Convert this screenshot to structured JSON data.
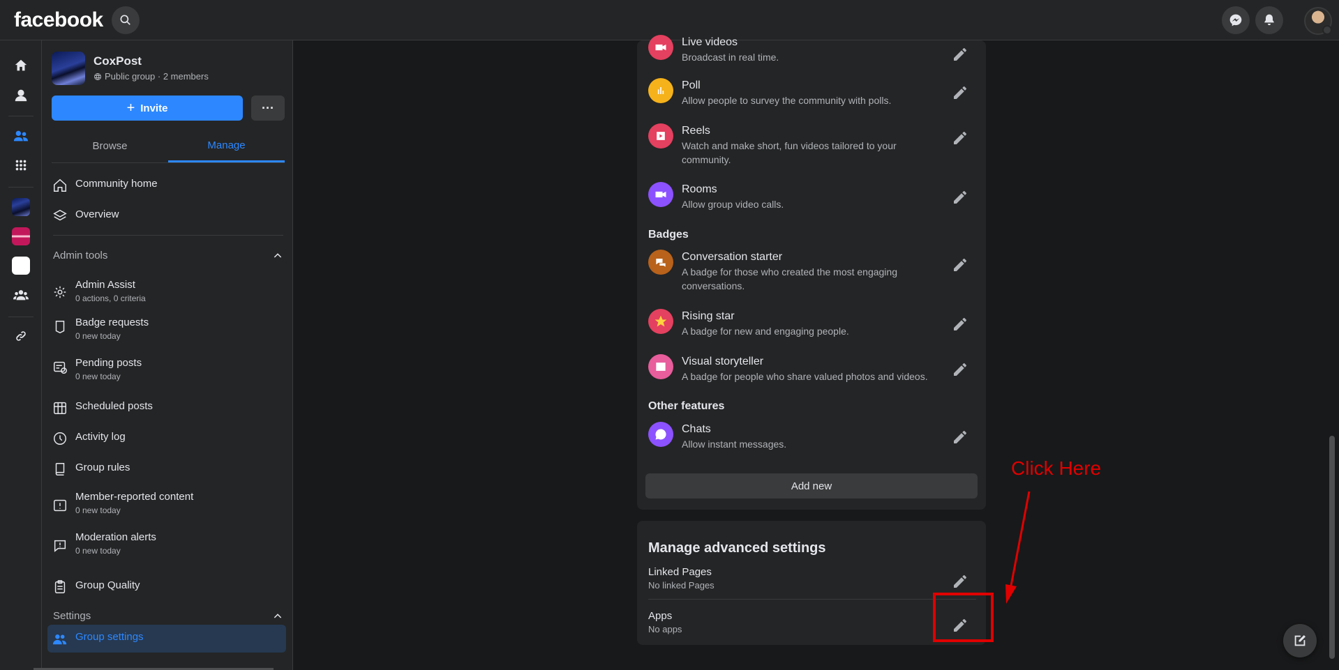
{
  "topbar": {
    "logo": "facebook"
  },
  "group": {
    "name": "CoxPost",
    "meta": "Public group · 2 members"
  },
  "actions": {
    "invite_label": "Invite",
    "more_label": "···"
  },
  "tabs": [
    {
      "label": "Browse"
    },
    {
      "label": "Manage"
    }
  ],
  "nav_top": [
    {
      "label": "Community home"
    },
    {
      "label": "Overview"
    }
  ],
  "admin_tools": {
    "title": "Admin tools",
    "items": [
      {
        "label": "Admin Assist",
        "sub": "0 actions, 0 criteria"
      },
      {
        "label": "Badge requests",
        "sub": "0 new today"
      },
      {
        "label": "Pending posts",
        "sub": "0 new today"
      },
      {
        "label": "Scheduled posts",
        "sub": ""
      },
      {
        "label": "Activity log",
        "sub": ""
      },
      {
        "label": "Group rules",
        "sub": ""
      },
      {
        "label": "Member-reported content",
        "sub": "0 new today"
      },
      {
        "label": "Moderation alerts",
        "sub": "0 new today"
      },
      {
        "label": "Group Quality",
        "sub": ""
      }
    ]
  },
  "settings": {
    "title": "Settings",
    "active_item": "Group settings"
  },
  "features": [
    {
      "title": "Live videos",
      "desc": "Broadcast in real time.",
      "color": "#e4405f"
    },
    {
      "title": "Poll",
      "desc": "Allow people to survey the community with polls.",
      "color": "#f5b21b"
    },
    {
      "title": "Reels",
      "desc": "Watch and make short, fun videos tailored to your community.",
      "color": "#e4405f"
    },
    {
      "title": "Rooms",
      "desc": "Allow group video calls.",
      "color": "#8c52ff"
    }
  ],
  "badges": {
    "title": "Badges",
    "items": [
      {
        "title": "Conversation starter",
        "desc": "A badge for those who created the most engaging conversations.",
        "color": "#b8621b"
      },
      {
        "title": "Rising star",
        "desc": "A badge for new and engaging people.",
        "color": "#e4405f"
      },
      {
        "title": "Visual storyteller",
        "desc": "A badge for people who share valued photos and videos.",
        "color": "#e85d9c"
      }
    ]
  },
  "other_features": {
    "title": "Other features",
    "items": [
      {
        "title": "Chats",
        "desc": "Allow instant messages.",
        "color": "#8c52ff"
      }
    ]
  },
  "add_new_label": "Add new",
  "advanced": {
    "title": "Manage advanced settings",
    "rows": [
      {
        "title": "Linked Pages",
        "sub": "No linked Pages"
      },
      {
        "title": "Apps",
        "sub": "No apps"
      }
    ]
  },
  "annotation": {
    "text": "Click Here",
    "color": "#e00000"
  }
}
